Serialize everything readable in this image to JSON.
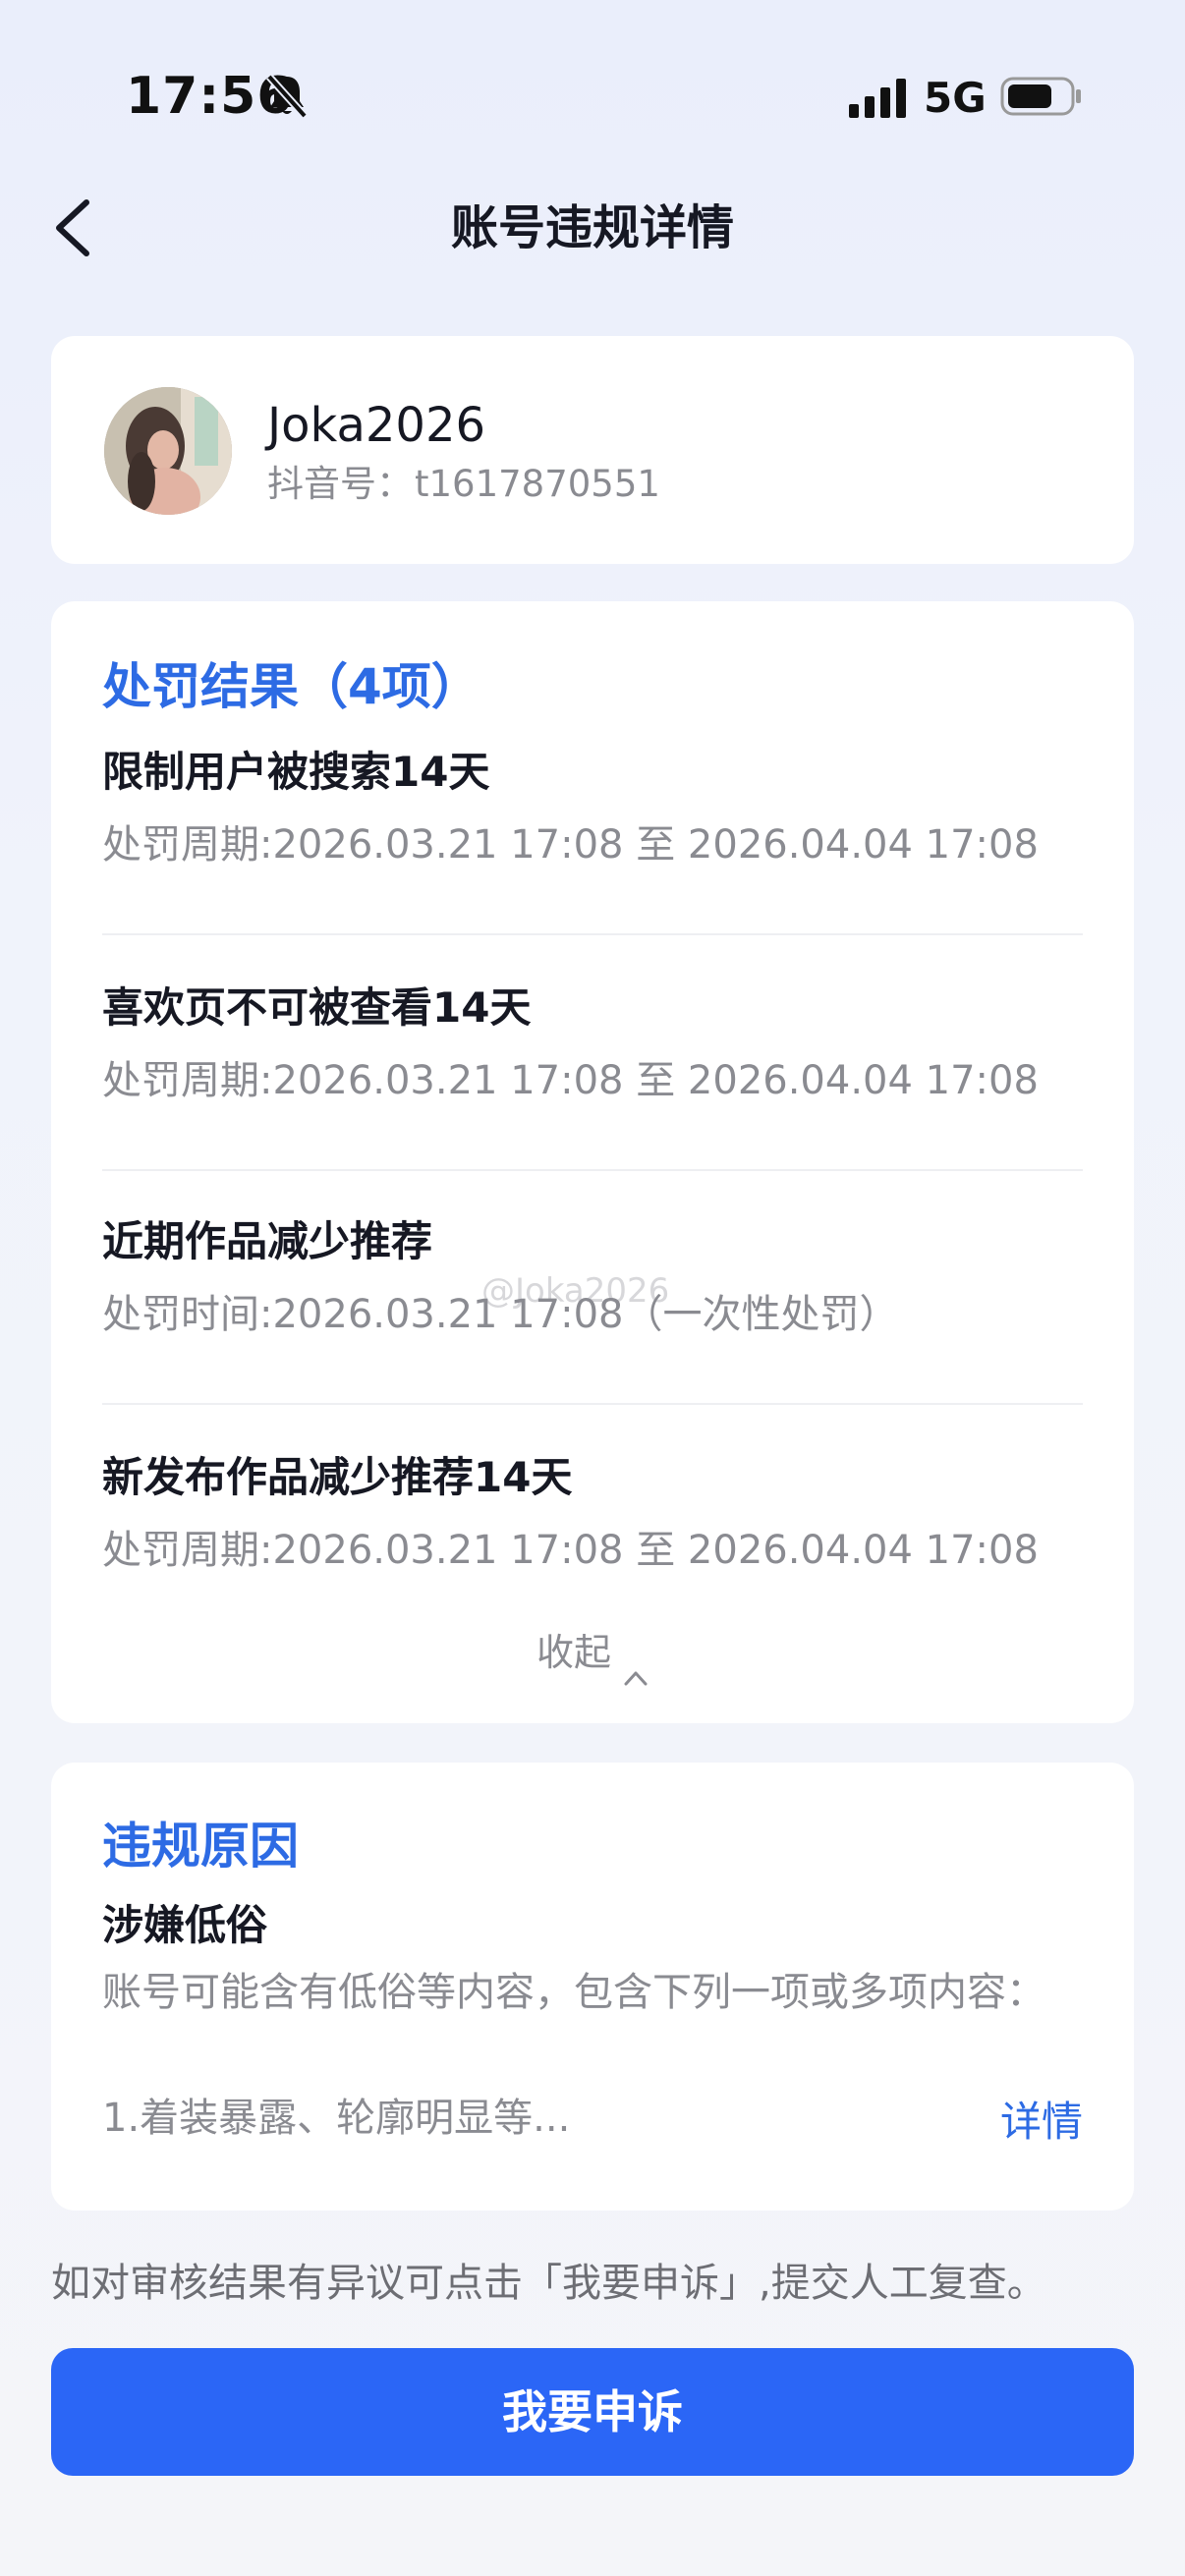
{
  "status_bar": {
    "time": "17:56",
    "network": "5G",
    "icons": [
      "bell-slash-icon",
      "signal-icon",
      "battery-icon"
    ]
  },
  "header": {
    "title": "账号违规详情",
    "back_icon": "chevron-left-icon"
  },
  "profile": {
    "username": "Joka2026",
    "id_label": "抖音号：",
    "id_value": "t1617870551"
  },
  "penalties": {
    "title": "处罚结果（4项）",
    "items": [
      {
        "title": "限制用户被搜索14天",
        "period": "处罚周期:2026.03.21 17:08 至 2026.04.04 17:08"
      },
      {
        "title": "喜欢页不可被查看14天",
        "period": "处罚周期:2026.03.21 17:08 至 2026.04.04 17:08"
      },
      {
        "title": "近期作品减少推荐",
        "period": "处罚时间:2026.03.21 17:08（一次性处罚）"
      },
      {
        "title": "新发布作品减少推荐14天",
        "period": "处罚周期:2026.03.21 17:08 至 2026.04.04 17:08"
      }
    ],
    "collapse_label": "收起"
  },
  "reason": {
    "title": "违规原因",
    "type": "涉嫌低俗",
    "description": "账号可能含有低俗等内容，包含下列一项或多项内容：",
    "item": "1.着装暴露、轮廓明显等...",
    "details_label": "详情"
  },
  "appeal": {
    "hint": "如对审核结果有异议可点击「我要申诉」,提交人工复查。",
    "button_label": "我要申诉"
  },
  "watermark": "@Joka2026",
  "colors": {
    "accent": "#2b66f6",
    "title_blue": "#2d6be4",
    "background": "#eef1fa"
  }
}
